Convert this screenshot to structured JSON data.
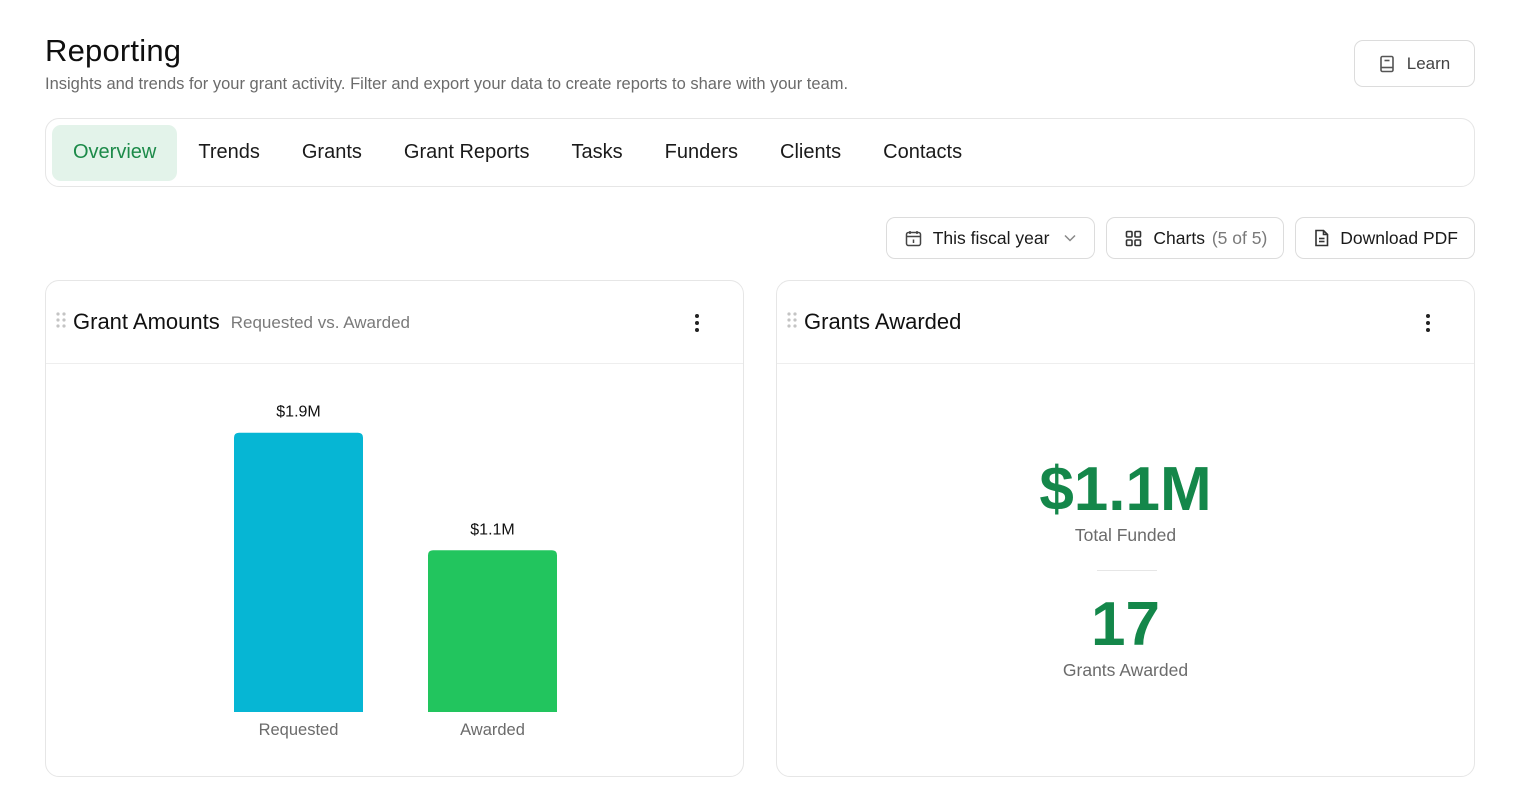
{
  "page": {
    "title": "Reporting",
    "subtitle": "Insights and trends for your grant activity. Filter and export your data to create reports to share with your team."
  },
  "learn_button": {
    "label": "Learn",
    "icon": "book-icon"
  },
  "tabs": [
    {
      "label": "Overview",
      "active": true
    },
    {
      "label": "Trends"
    },
    {
      "label": "Grants"
    },
    {
      "label": "Grant Reports"
    },
    {
      "label": "Tasks"
    },
    {
      "label": "Funders"
    },
    {
      "label": "Clients"
    },
    {
      "label": "Contacts"
    }
  ],
  "toolbar": {
    "date_filter": {
      "label": "This fiscal year",
      "icon": "calendar-icon"
    },
    "charts": {
      "label": "Charts",
      "count": "(5 of 5)",
      "icon": "grid-icon"
    },
    "download": {
      "label": "Download PDF",
      "icon": "document-icon"
    }
  },
  "grant_amounts_card": {
    "title": "Grant Amounts",
    "subtitle": "Requested vs. Awarded"
  },
  "grants_awarded_card": {
    "title": "Grants Awarded",
    "total_funded_value": "$1.1M",
    "total_funded_label": "Total Funded",
    "count_value": "17",
    "count_label": "Grants Awarded"
  },
  "colors": {
    "accent_green": "#14874a",
    "tab_active_bg": "#e3f3ea",
    "requested_bar": "#06b6d4",
    "awarded_bar": "#22c55e"
  },
  "chart_data": {
    "type": "bar",
    "categories": [
      "Requested",
      "Awarded"
    ],
    "values": [
      1.9,
      1.1
    ],
    "value_labels": [
      "$1.9M",
      "$1.1M"
    ],
    "colors": [
      "#06b6d4",
      "#22c55e"
    ],
    "ylim": [
      0,
      2
    ],
    "grid": false
  }
}
